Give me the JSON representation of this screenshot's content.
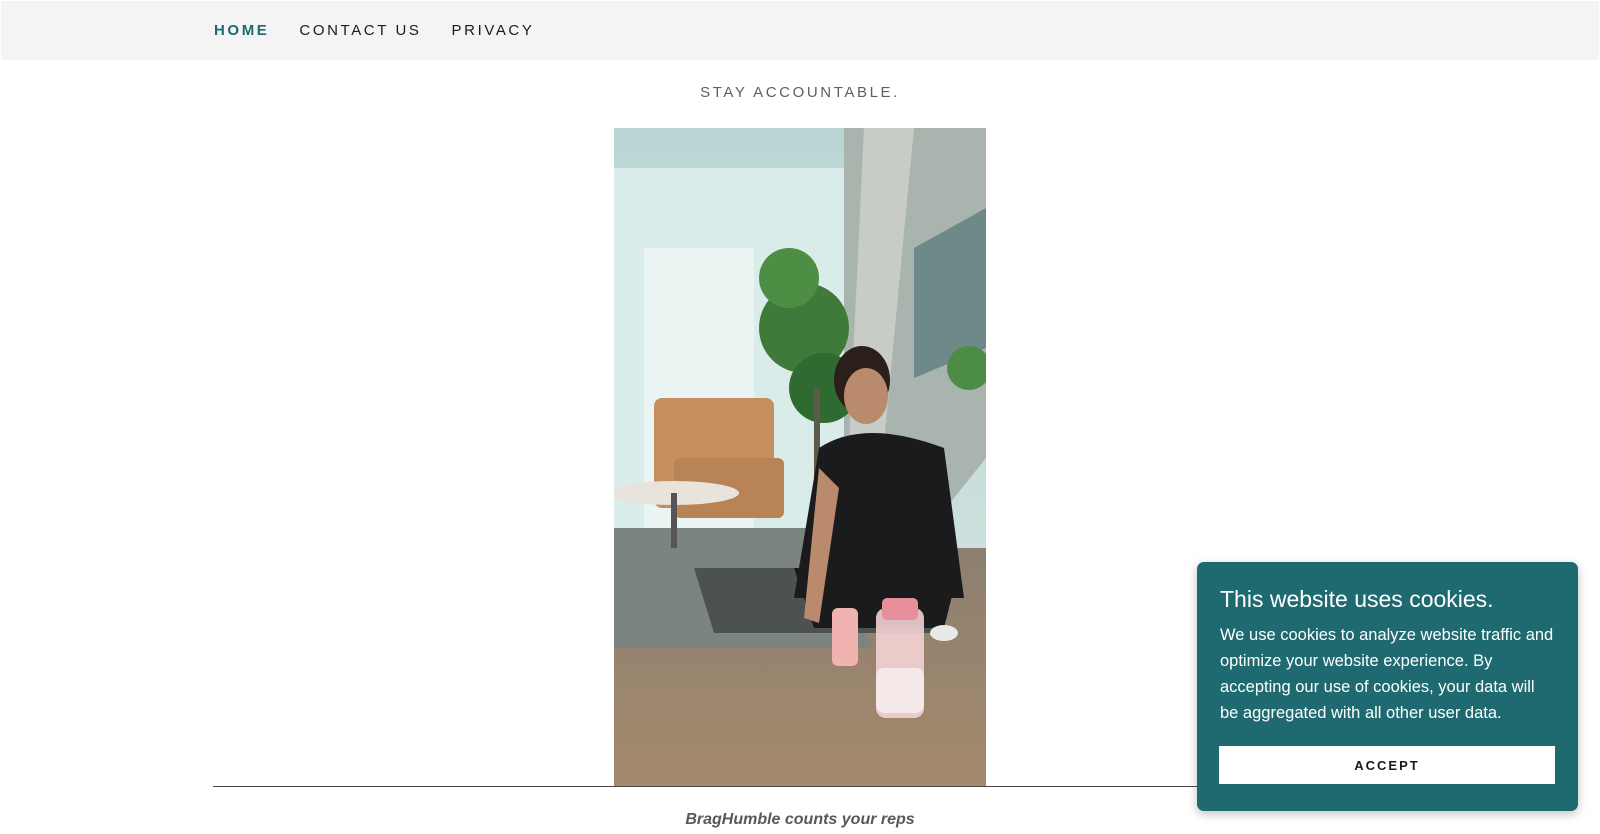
{
  "nav": {
    "items": [
      {
        "label": "HOME",
        "active": true
      },
      {
        "label": "CONTACT US",
        "active": false
      },
      {
        "label": "PRIVACY",
        "active": false
      }
    ]
  },
  "hero": {
    "tagline": "STAY ACCOUNTABLE.",
    "video_alt": "woman setting down a phone and water bottle on a living-room floor",
    "caption": "BragHumble counts your reps"
  },
  "cookie_banner": {
    "title": "This website uses cookies.",
    "body": "We use cookies to analyze website traffic and optimize your website experience. By accepting our use of cookies, your data will be aggregated with all other user data.",
    "accept_label": "ACCEPT"
  },
  "colors": {
    "accent": "#1c6a70",
    "cookie_bg": "#1f6a70",
    "nav_bg": "#f4f4f4"
  }
}
